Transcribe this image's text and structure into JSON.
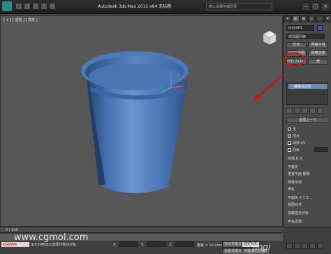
{
  "titlebar": {
    "title": "Autodesk 3ds Max  2012 x64   无标题",
    "search_placeholder": "键入关键字或短语"
  },
  "viewport": {
    "label": "[ + ] [ 透视 ] [ 真实 ]"
  },
  "command_panel": {
    "object_name": "plane01",
    "modifier_list": "修改器列表",
    "buttons": [
      "优化",
      "网格平滑",
      "UVW 贴图",
      "网格选择",
      "FFD 2x2x2",
      "壳"
    ],
    "stack_item": "编辑多边形",
    "rollout_title": "量置上一个",
    "rows": [
      {
        "kind": "radio",
        "label": "无"
      },
      {
        "kind": "radio",
        "label": "顶点"
      },
      {
        "kind": "check",
        "label": "保持 UV"
      },
      {
        "kind": "check",
        "label": "约束"
      },
      {
        "kind": "text",
        "label": "收缩   扩大"
      },
      {
        "kind": "text",
        "label": "平面化"
      },
      {
        "kind": "text",
        "label": "重置平面  删除"
      },
      {
        "kind": "text",
        "label": "网格平滑"
      },
      {
        "kind": "text",
        "label": "细化"
      },
      {
        "kind": "text",
        "label": "平面化   X  Y  Z"
      },
      {
        "kind": "text",
        "label": "视图对齐"
      },
      {
        "kind": "text",
        "label": "隐藏选定对象"
      },
      {
        "kind": "text",
        "label": "命名选择:"
      }
    ]
  },
  "timeslider": {
    "label": "0 / 100"
  },
  "statusbar": {
    "maxscript": "欢迎使用",
    "prompt": "单击并拖动以选择并移动对象",
    "x_label": "X:",
    "x_value": "",
    "y_label": "Y:",
    "y_value": "",
    "z_label": "Z:",
    "z_value": "",
    "grid": "栅格 = 10.0mm",
    "autokey": "自动关键点",
    "selected": "选定对象",
    "setkey": "设置关键点",
    "filter": "关键点过滤器..."
  },
  "watermark": "www.cgmol.com",
  "watermark_right": "jingi",
  "colors": {
    "cup": "#4f7bb8",
    "annotation": "#d01010"
  }
}
